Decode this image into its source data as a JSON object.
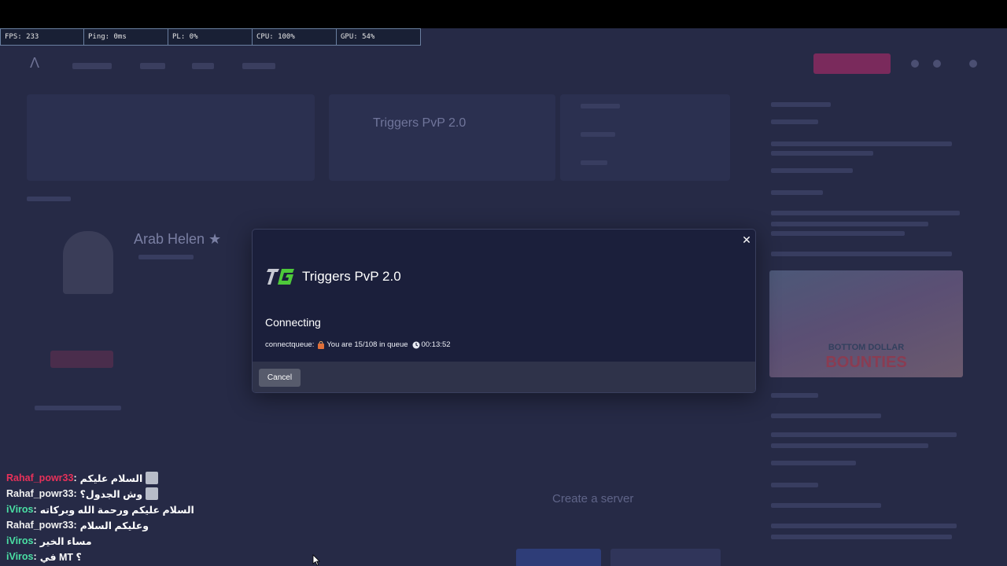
{
  "stats": {
    "fps": "FPS: 233",
    "ping": "Ping: 0ms",
    "pl": "PL: 0%",
    "cpu": "CPU: 100%",
    "gpu": "GPU: 54%"
  },
  "background": {
    "server_name": "Triggers PvP 2.0",
    "profile_name": "Arab Helen ★",
    "poster_title": "BOTTOM DOLLAR",
    "poster_subtitle": "BOUNTIES",
    "create_server": "Create a server"
  },
  "modal": {
    "server_name": "Triggers PvP 2.0",
    "logo_text": "TG",
    "status": "Connecting",
    "queue_prefix": "connectqueue:",
    "queue_text": "You are 15/108 in queue",
    "queue_time": "00:13:52",
    "cancel_label": "Cancel",
    "close_icon": "close-icon",
    "logo_color": "#4ec93a"
  },
  "chat": [
    {
      "user": "Rahaf_powr33",
      "user_color": "#e8315a",
      "message": "السلام عليكم",
      "emote": true
    },
    {
      "user": "Rahaf_powr33",
      "user_color": "#f1f1f1",
      "message": "وش الجدول؟",
      "emote": true
    },
    {
      "user": "iViros",
      "user_color": "#4ae0a4",
      "message": "السلام عليكم ورحمة الله وبركاته",
      "emote": false
    },
    {
      "user": "Rahaf_powr33",
      "user_color": "#f1f1f1",
      "message": "وعليكم السلام",
      "emote": false
    },
    {
      "user": "iViros",
      "user_color": "#4ae0a4",
      "message": "مساء الخير",
      "emote": false
    },
    {
      "user": "iViros",
      "user_color": "#4ae0a4",
      "message": "في MT ؟",
      "emote": false
    }
  ]
}
